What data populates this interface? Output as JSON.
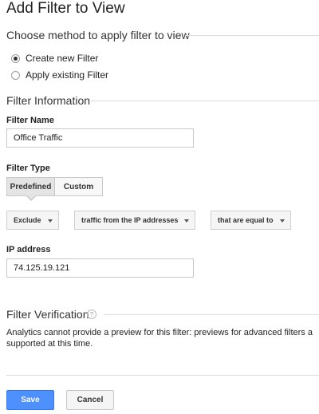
{
  "page": {
    "title": "Add Filter to View"
  },
  "method": {
    "heading": "Choose method to apply filter to view",
    "options": [
      {
        "label": "Create new Filter",
        "selected": true
      },
      {
        "label": "Apply existing Filter",
        "selected": false
      }
    ]
  },
  "filter_info": {
    "heading": "Filter Information",
    "name_label": "Filter Name",
    "name_value": "Office Traffic",
    "type_label": "Filter Type",
    "type_tabs": [
      {
        "label": "Predefined",
        "active": true
      },
      {
        "label": "Custom",
        "active": false
      }
    ],
    "dropdowns": {
      "action": "Exclude",
      "source": "traffic from the IP addresses",
      "expression": "that are equal to"
    },
    "ip_label": "IP address",
    "ip_value": "74.125.19.121"
  },
  "verification": {
    "heading": "Filter Verification",
    "help_icon": "question-circle-icon",
    "text_line1": "Analytics cannot provide a preview for this filter: previews for advanced filters a",
    "text_line2": "supported at this time."
  },
  "actions": {
    "save_label": "Save",
    "cancel_label": "Cancel"
  },
  "colors": {
    "primary_button": "#4d90fe",
    "divider": "#dcdcdc"
  }
}
